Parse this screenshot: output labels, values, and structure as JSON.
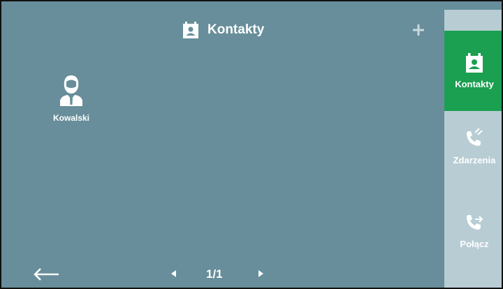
{
  "header": {
    "title": "Kontakty",
    "title_icon": "contacts-book-icon",
    "add_icon": "plus-icon"
  },
  "contacts": [
    {
      "name": "Kowalski",
      "icon": "person-avatar-icon"
    }
  ],
  "pagination": {
    "back_icon": "arrow-left-icon",
    "prev_icon": "triangle-left-icon",
    "page": "1/1",
    "next_icon": "triangle-right-icon"
  },
  "sidebar": {
    "items": [
      {
        "label": "Kontakty",
        "icon": "contacts-book-icon",
        "active": true
      },
      {
        "label": "Zdarzenia",
        "icon": "phone-events-icon",
        "active": false
      },
      {
        "label": "Połącz",
        "icon": "phone-call-icon",
        "active": false
      }
    ]
  },
  "colors": {
    "background": "#678e9a",
    "sidebar": "#b8ccd4",
    "active": "#1b9f51",
    "text": "#ffffff"
  }
}
